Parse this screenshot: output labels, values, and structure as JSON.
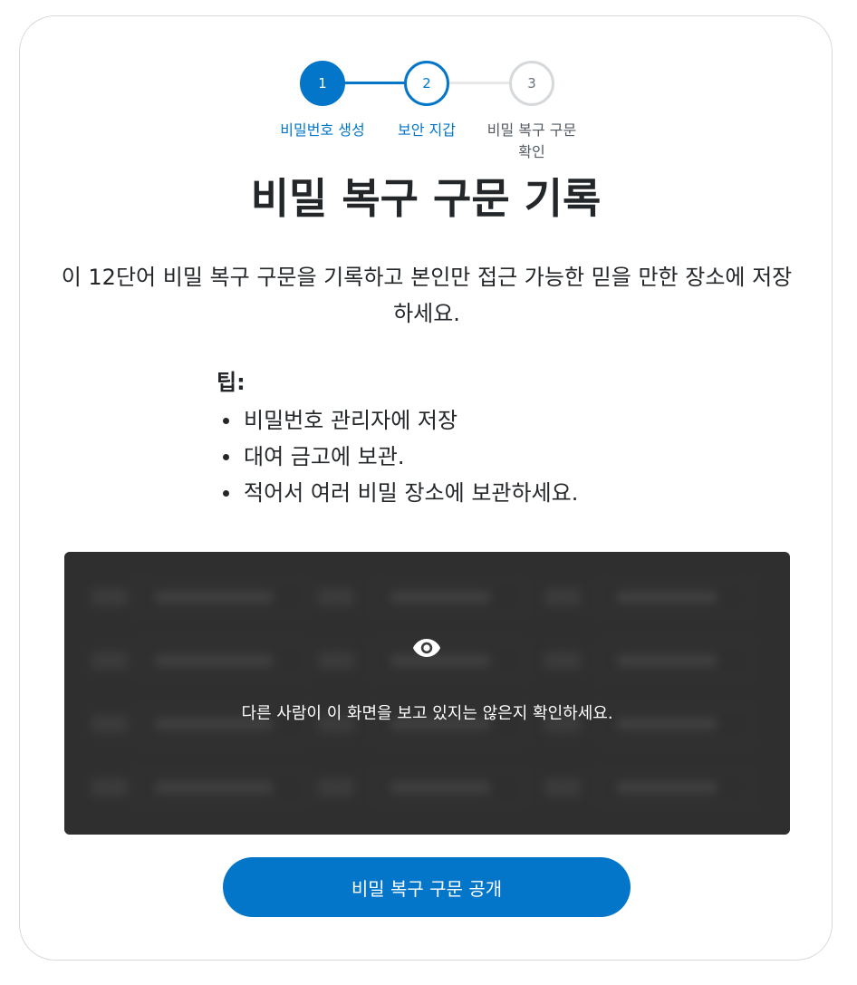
{
  "stepper": {
    "steps": [
      {
        "number": "1",
        "label": "비밀번호 생성",
        "state": "complete"
      },
      {
        "number": "2",
        "label": "보안 지갑",
        "state": "active"
      },
      {
        "number": "3",
        "label": "비밀 복구 구문 확인",
        "state": "upcoming"
      }
    ]
  },
  "main": {
    "title": "비밀 복구 구문 기록",
    "description": "이 12단어 비밀 복구 구문을 기록하고 본인만 접근 가능한 믿을 만한 장소에 저장하세요.",
    "tips": {
      "heading": "팁:",
      "items": [
        "비밀번호 관리자에 저장",
        "대여 금고에 보관.",
        "적어서 여러 비밀 장소에 보관하세요."
      ]
    }
  },
  "phrase_box": {
    "icon": "eye-icon",
    "warning": "다른 사람이 이 화면을 보고 있지는 않은지 확인하세요."
  },
  "actions": {
    "reveal_label": "비밀 복구 구문 공개"
  },
  "colors": {
    "accent": "#0376c9",
    "overlay": "#323232",
    "text": "#24272a",
    "inactive": "#d6d9dc"
  }
}
